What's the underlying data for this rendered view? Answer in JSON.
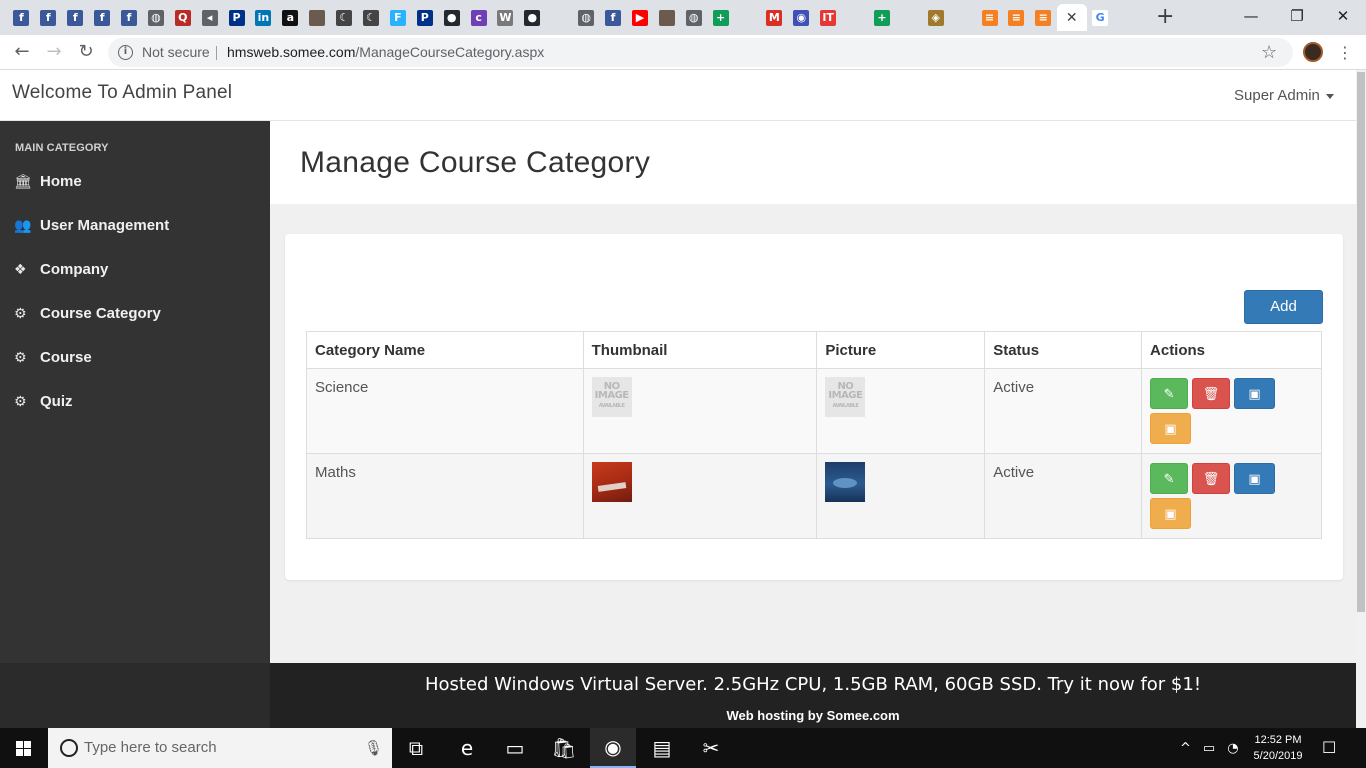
{
  "browser": {
    "tabs": [
      {
        "icon": "facebook-icon",
        "glyph": "f",
        "color": "#3b5998"
      },
      {
        "icon": "facebook-icon",
        "glyph": "f",
        "color": "#3b5998"
      },
      {
        "icon": "facebook-icon",
        "glyph": "f",
        "color": "#3b5998"
      },
      {
        "icon": "facebook-icon",
        "glyph": "f",
        "color": "#3b5998"
      },
      {
        "icon": "facebook-icon",
        "glyph": "f",
        "color": "#3b5998"
      },
      {
        "icon": "globe-icon",
        "glyph": "◍",
        "color": "#5f6368"
      },
      {
        "icon": "quora-icon",
        "glyph": "Q",
        "color": "#b92b27"
      },
      {
        "icon": "speaker-icon",
        "glyph": "◂",
        "color": "#5f6368"
      },
      {
        "icon": "paypal-icon",
        "glyph": "P",
        "color": "#003087"
      },
      {
        "icon": "linkedin-icon",
        "glyph": "in",
        "color": "#0077b5"
      },
      {
        "icon": "amazon-icon",
        "glyph": "a",
        "color": "#111111"
      },
      {
        "icon": "photo-icon",
        "glyph": "",
        "color": "#6b5b4e"
      },
      {
        "icon": "crescent-icon",
        "glyph": "☾",
        "color": "#444444"
      },
      {
        "icon": "crescent-icon",
        "glyph": "☾",
        "color": "#444444"
      },
      {
        "icon": "freelancer-icon",
        "glyph": "F",
        "color": "#29b2fe"
      },
      {
        "icon": "paypal-icon",
        "glyph": "P",
        "color": "#003087"
      },
      {
        "icon": "github-icon",
        "glyph": "●",
        "color": "#24292e"
      },
      {
        "icon": "colorlib-icon",
        "glyph": "c",
        "color": "#6f3fb5"
      },
      {
        "icon": "wordpress-icon",
        "glyph": "W",
        "color": "#7a7a7a"
      },
      {
        "icon": "github-icon",
        "glyph": "●",
        "color": "#24292e"
      },
      {
        "icon": "blank-icon",
        "glyph": "",
        "color": "#dee1e6"
      },
      {
        "icon": "globe-icon",
        "glyph": "◍",
        "color": "#5f6368"
      },
      {
        "icon": "facebook-icon",
        "glyph": "f",
        "color": "#3b5998"
      },
      {
        "icon": "youtube-icon",
        "glyph": "▶",
        "color": "#ff0000"
      },
      {
        "icon": "photo-icon",
        "glyph": "",
        "color": "#6b5b4e"
      },
      {
        "icon": "globe-icon",
        "glyph": "◍",
        "color": "#5f6368"
      },
      {
        "icon": "sheets-icon",
        "glyph": "+",
        "color": "#0f9d58"
      },
      {
        "icon": "blank-icon",
        "glyph": "",
        "color": "#dee1e6"
      },
      {
        "icon": "gmail-icon",
        "glyph": "M",
        "color": "#d93025"
      },
      {
        "icon": "circle-icon",
        "glyph": "◉",
        "color": "#3f51b5"
      },
      {
        "icon": "itsection-icon",
        "glyph": "IT",
        "color": "#e53935"
      },
      {
        "icon": "blank-icon",
        "glyph": "",
        "color": "#dee1e6"
      },
      {
        "icon": "sheets-icon",
        "glyph": "+",
        "color": "#0f9d58"
      },
      {
        "icon": "blank-icon",
        "glyph": "",
        "color": "#dee1e6"
      },
      {
        "icon": "badge-icon",
        "glyph": "◈",
        "color": "#a07a2c"
      },
      {
        "icon": "blank-icon",
        "glyph": "",
        "color": "#dee1e6"
      },
      {
        "icon": "stackoverflow-icon",
        "glyph": "≡",
        "color": "#f48024"
      },
      {
        "icon": "stackoverflow-icon",
        "glyph": "≡",
        "color": "#f48024"
      },
      {
        "icon": "stackoverflow-icon",
        "glyph": "≡",
        "color": "#f48024"
      }
    ],
    "active_tab_close": "✕",
    "next_tab": {
      "icon": "google-icon",
      "glyph": "G",
      "color": "#4285f4"
    },
    "new_tab": "+",
    "window_buttons": {
      "minimize": "—",
      "restore": "❐",
      "close": "✕"
    },
    "nav": {
      "back": "←",
      "forward": "→",
      "reload": "↻"
    },
    "security_label": "Not secure",
    "url_host": "hmsweb.somee.com",
    "url_path": "/ManageCourseCategory.aspx",
    "star": "☆",
    "menu": "⋮"
  },
  "header": {
    "brand": "Welcome To Admin Panel",
    "user": "Super Admin"
  },
  "sidebar": {
    "heading": "MAIN CATEGORY",
    "items": [
      {
        "label": "Home",
        "icon": "bank-icon",
        "glyph": "🏛"
      },
      {
        "label": "User Management",
        "icon": "users-icon",
        "glyph": "👥"
      },
      {
        "label": "Company",
        "icon": "cubes-icon",
        "glyph": "❖"
      },
      {
        "label": "Course Category",
        "icon": "gear-icon",
        "glyph": "⚙"
      },
      {
        "label": "Course",
        "icon": "gear-icon",
        "glyph": "⚙"
      },
      {
        "label": "Quiz",
        "icon": "gear-icon",
        "glyph": "⚙"
      }
    ]
  },
  "main": {
    "title": "Manage Course Category",
    "add_label": "Add",
    "columns": [
      "Category Name",
      "Thumbnail",
      "Picture",
      "Status",
      "Actions"
    ],
    "rows": [
      {
        "name": "Science",
        "thumbnail": "no-image",
        "picture": "no-image",
        "status": "Active"
      },
      {
        "name": "Maths",
        "thumbnail": "book-cover-red",
        "picture": "book-cover-blue",
        "status": "Active"
      }
    ],
    "no_image_text": {
      "line1": "NO",
      "line2": "IMAGE",
      "line3": "AVAILABLE"
    },
    "action_glyphs": {
      "edit": "✎",
      "delete": "🗑",
      "image": "▣",
      "image_alt": "▣"
    }
  },
  "footer": {
    "ad_text": "Hosted Windows Virtual Server. 2.5GHz CPU, 1.5GB RAM, 60GB SSD. Try it now for $1!",
    "ad_sub": "Web hosting by Somee.com"
  },
  "taskbar": {
    "search_placeholder": "Type here to search",
    "time": "12:52 PM",
    "date": "5/20/2019",
    "apps": [
      {
        "icon": "task-view-icon",
        "glyph": "⧉"
      },
      {
        "icon": "edge-icon",
        "glyph": "e"
      },
      {
        "icon": "file-explorer-icon",
        "glyph": "▭"
      },
      {
        "icon": "store-icon",
        "glyph": "🛍"
      },
      {
        "icon": "chrome-icon",
        "glyph": "◉"
      },
      {
        "icon": "notepad-icon",
        "glyph": "▤"
      },
      {
        "icon": "tools-icon",
        "glyph": "✂"
      }
    ],
    "tray": {
      "chevron": "^",
      "network": "▭",
      "wifi": "◔",
      "notifications": "☐"
    }
  }
}
